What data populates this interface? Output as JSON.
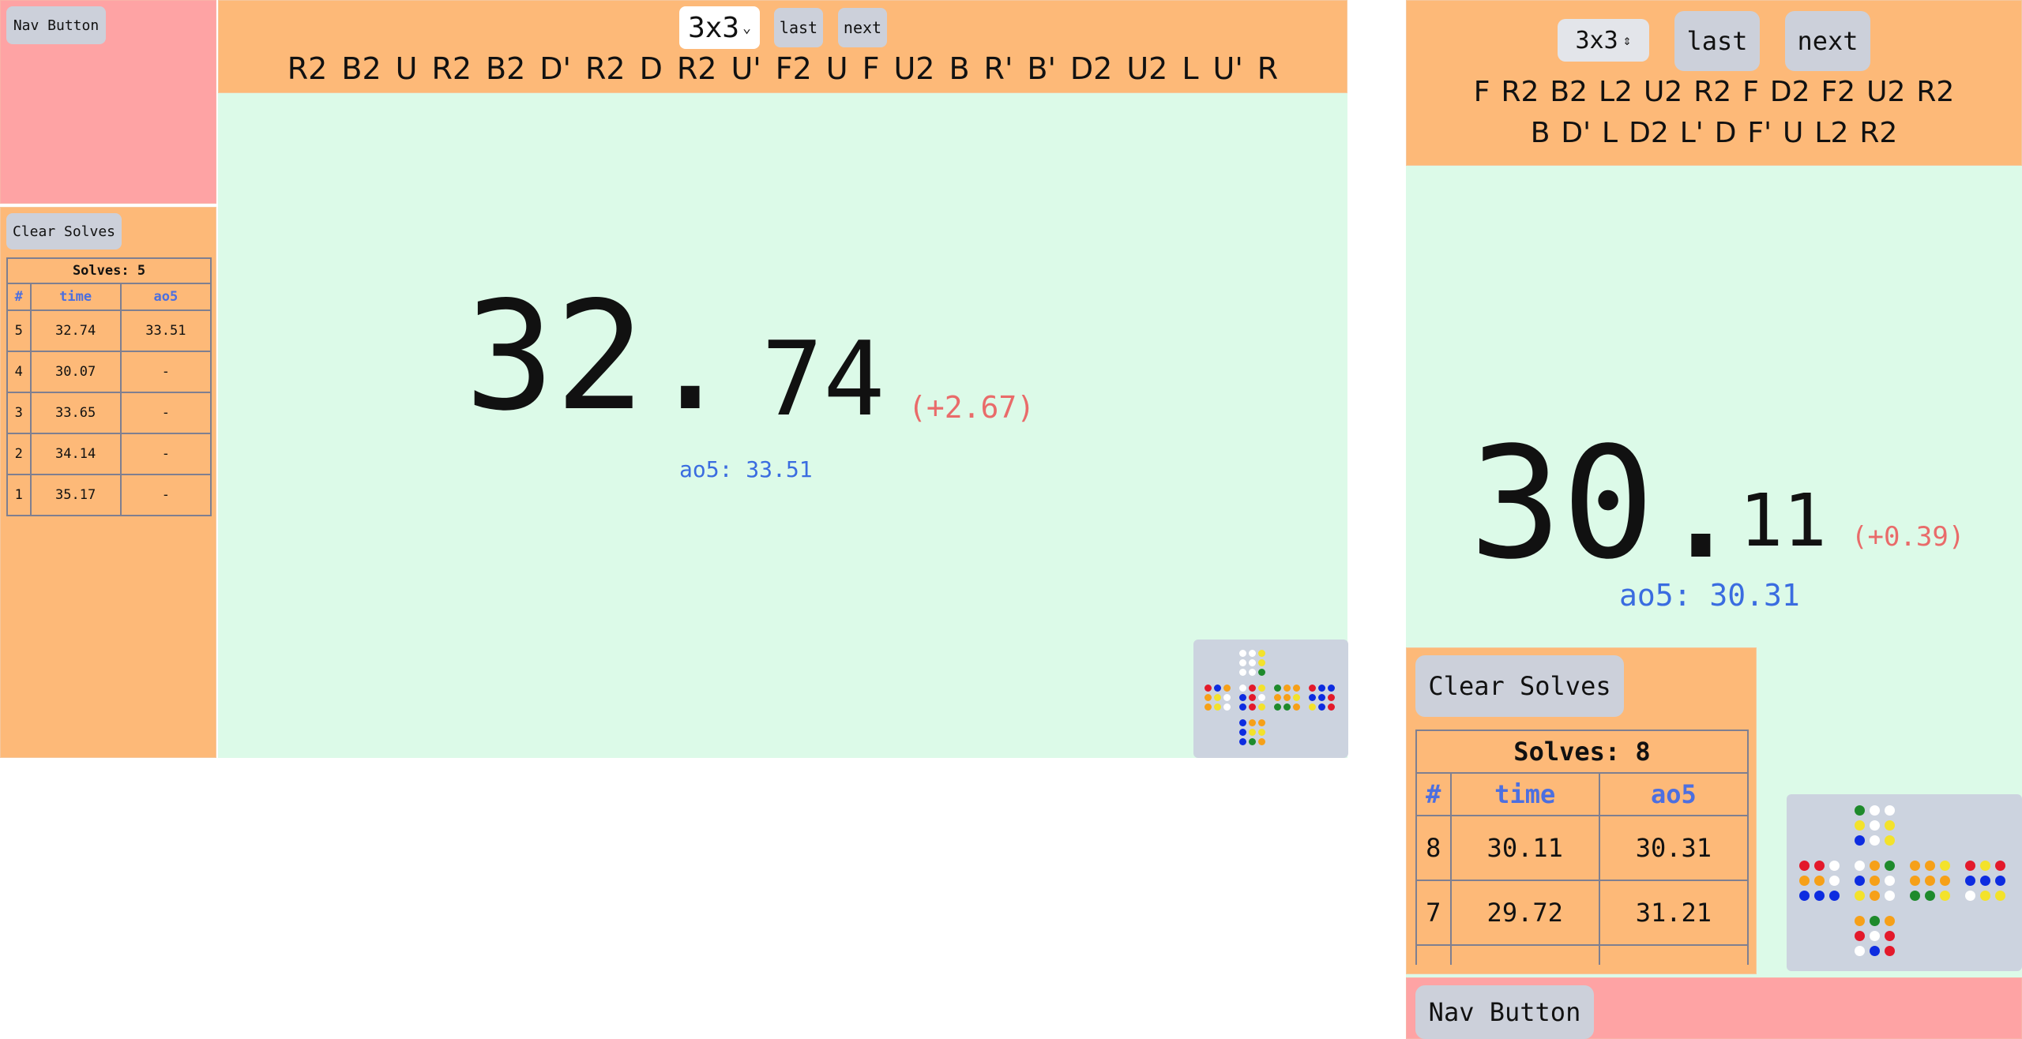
{
  "left": {
    "nav_button": "Nav Button",
    "clear_button": "Clear Solves",
    "puzzle_select": "3x3",
    "last_button": "last",
    "next_button": "next",
    "scramble": [
      "R2",
      "B2",
      "U",
      "R2",
      "B2",
      "D'",
      "R2",
      "D",
      "R2",
      "U'",
      "F2",
      "U",
      "F",
      "U2",
      "B",
      "R'",
      "B'",
      "D2",
      "U2",
      "L",
      "U'",
      "R"
    ],
    "timer": {
      "whole": "32.",
      "decimal": "74",
      "delta": "(+2.67)",
      "ao5_label": "ao5: 33.51"
    },
    "table": {
      "title": "Solves: 5",
      "headers": [
        "#",
        "time",
        "ao5"
      ],
      "rows": [
        [
          "5",
          "32.74",
          "33.51"
        ],
        [
          "4",
          "30.07",
          "-"
        ],
        [
          "3",
          "33.65",
          "-"
        ],
        [
          "2",
          "34.14",
          "-"
        ],
        [
          "1",
          "35.17",
          "-"
        ]
      ]
    },
    "cube_net": {
      "U": [
        "W",
        "W",
        "Y",
        "W",
        "W",
        "Y",
        "W",
        "W",
        "G"
      ],
      "L": [
        "R",
        "B",
        "O",
        "O",
        "Y",
        "W",
        "O",
        "Y",
        "W"
      ],
      "F": [
        "W",
        "R",
        "Y",
        "B",
        "R",
        "W",
        "B",
        "R",
        "Y"
      ],
      "R": [
        "G",
        "O",
        "O",
        "O",
        "O",
        "Y",
        "G",
        "G",
        "O"
      ],
      "B": [
        "R",
        "B",
        "B",
        "B",
        "B",
        "R",
        "Y",
        "B",
        "R"
      ],
      "D": [
        "B",
        "O",
        "O",
        "B",
        "Y",
        "Y",
        "B",
        "G",
        "O"
      ]
    }
  },
  "right": {
    "puzzle_select": "3x3",
    "last_button": "last",
    "next_button": "next",
    "scramble_line1": [
      "F",
      "R2",
      "B2",
      "L2",
      "U2",
      "R2",
      "F",
      "D2",
      "F2",
      "U2",
      "R2"
    ],
    "scramble_line2": [
      "B",
      "D'",
      "L",
      "D2",
      "L'",
      "D",
      "F'",
      "U",
      "L2",
      "R2"
    ],
    "timer": {
      "whole": "30.",
      "decimal": "11",
      "delta": "(+0.39)",
      "ao5_label": "ao5: 30.31"
    },
    "clear_button": "Clear Solves",
    "table": {
      "title": "Solves: 8",
      "headers": [
        "#",
        "time",
        "ao5"
      ],
      "rows": [
        [
          "8",
          "30.11",
          "30.31"
        ],
        [
          "7",
          "29.72",
          "31.21"
        ],
        [
          "",
          "",
          ""
        ]
      ]
    },
    "nav_button": "Nav Button",
    "cube_net": {
      "U": [
        "G",
        "W",
        "W",
        "Y",
        "W",
        "Y",
        "B",
        "W",
        "Y"
      ],
      "L": [
        "R",
        "R",
        "W",
        "O",
        "O",
        "W",
        "B",
        "B",
        "B"
      ],
      "F": [
        "W",
        "O",
        "G",
        "B",
        "O",
        "W",
        "Y",
        "O",
        "W"
      ],
      "R": [
        "O",
        "O",
        "Y",
        "O",
        "O",
        "O",
        "G",
        "G",
        "Y"
      ],
      "B": [
        "R",
        "Y",
        "R",
        "B",
        "B",
        "B",
        "W",
        "Y",
        "Y"
      ],
      "D": [
        "O",
        "G",
        "O",
        "R",
        "W",
        "R",
        "W",
        "B",
        "R"
      ]
    }
  },
  "colors": {
    "W": "#ffffff",
    "Y": "#f3e22b",
    "R": "#e3192b",
    "O": "#f6a018",
    "G": "#1e8a2c",
    "B": "#0d2ce0"
  }
}
